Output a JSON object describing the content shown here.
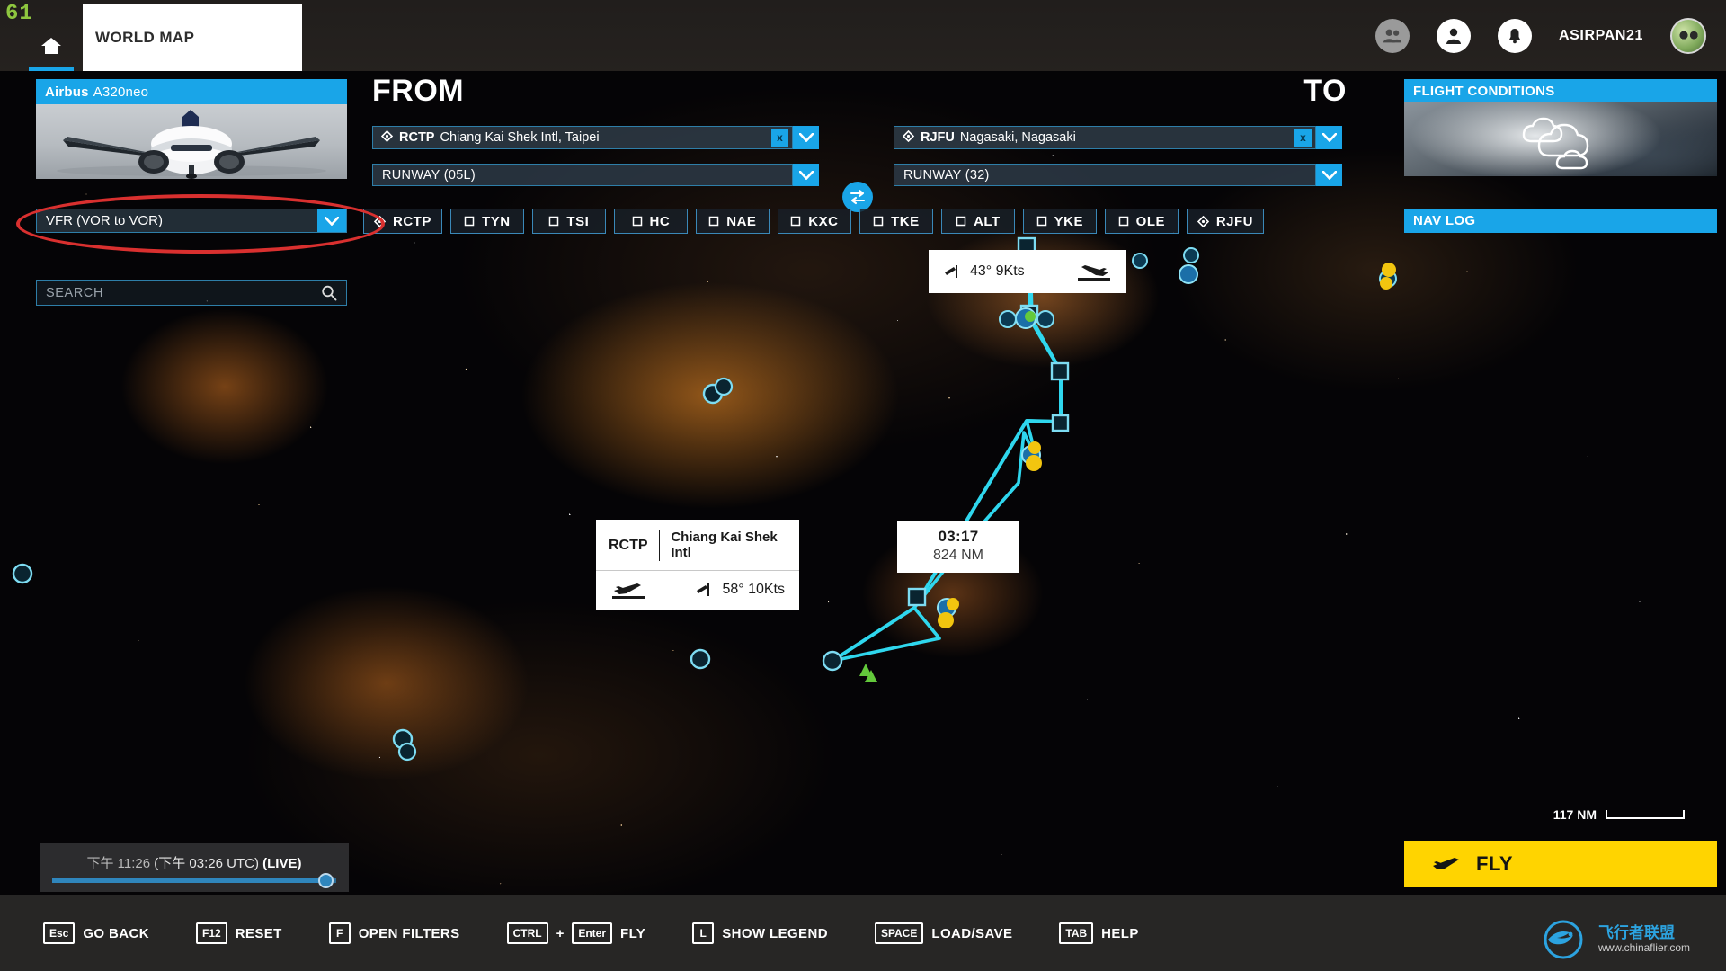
{
  "topbar": {
    "logo": "61",
    "home_icon": "home-icon",
    "tab_label": "WORLD MAP",
    "icons": [
      "friends-icon",
      "profile-icon",
      "notifications-icon"
    ],
    "username": "ASIRPAN21"
  },
  "aircraft": {
    "brand": "Airbus",
    "model": "A320neo",
    "image_alt": "airbus-a320neo-front-view"
  },
  "route": {
    "from_label": "FROM",
    "to_label": "TO",
    "departure": {
      "code": "RCTP",
      "name": "Chiang Kai Shek Intl, Taipei",
      "clear": "x",
      "runway": "RUNWAY (05L)"
    },
    "arrival": {
      "code": "RJFU",
      "name": "Nagasaki, Nagasaki",
      "clear": "x",
      "runway": "RUNWAY (32)"
    },
    "swap_icon": "swap-arrows-icon"
  },
  "flight_conditions": {
    "title": "FLIGHT CONDITIONS",
    "icon": "clouds-icon"
  },
  "nav_log": {
    "title": "NAV LOG"
  },
  "plan": {
    "type": "VFR (VOR to VOR)",
    "search_placeholder": "SEARCH",
    "waypoints": [
      {
        "id": "RCTP",
        "kind": "airport"
      },
      {
        "id": "TYN",
        "kind": "vor"
      },
      {
        "id": "TSI",
        "kind": "vor"
      },
      {
        "id": "HC",
        "kind": "vor"
      },
      {
        "id": "NAE",
        "kind": "vor"
      },
      {
        "id": "KXC",
        "kind": "vor"
      },
      {
        "id": "TKE",
        "kind": "vor"
      },
      {
        "id": "ALT",
        "kind": "vor"
      },
      {
        "id": "YKE",
        "kind": "vor"
      },
      {
        "id": "OLE",
        "kind": "vor"
      },
      {
        "id": "RJFU",
        "kind": "airport"
      }
    ]
  },
  "map": {
    "departure_tooltip": {
      "code": "RCTP",
      "name": "Chiang Kai Shek Intl",
      "wind": "58° 10Kts",
      "icon": "takeoff-icon"
    },
    "arrival_tooltip": {
      "wind": "43° 9Kts",
      "icon": "landing-icon"
    },
    "distance_tooltip": {
      "time": "03:17",
      "distance": "824 NM"
    },
    "scale": "117 NM",
    "route_color": "#2fd7ee"
  },
  "time": {
    "local": "下午 11:26",
    "utc": "(下午 03:26 UTC)",
    "live": "(LIVE)"
  },
  "fly": {
    "label": "FLY",
    "icon": "plane-icon"
  },
  "shortcuts": [
    {
      "key": "Esc",
      "label": "GO BACK"
    },
    {
      "key": "F12",
      "label": "RESET"
    },
    {
      "key": "F",
      "label": "OPEN FILTERS"
    },
    {
      "key": "CTRL",
      "key2": "Enter",
      "sep": "+",
      "label": "FLY"
    },
    {
      "key": "L",
      "label": "SHOW LEGEND"
    },
    {
      "key": "SPACE",
      "label": "LOAD/SAVE"
    },
    {
      "key": "TAB",
      "label": "HELP"
    }
  ],
  "watermark": {
    "cn": "飞行者联盟",
    "url": "www.chinaflier.com"
  },
  "colors": {
    "accent": "#19a5e8",
    "fly": "#ffd400",
    "route": "#2fd7ee",
    "annotation": "#d9302f",
    "logo": "#8ec63f"
  }
}
